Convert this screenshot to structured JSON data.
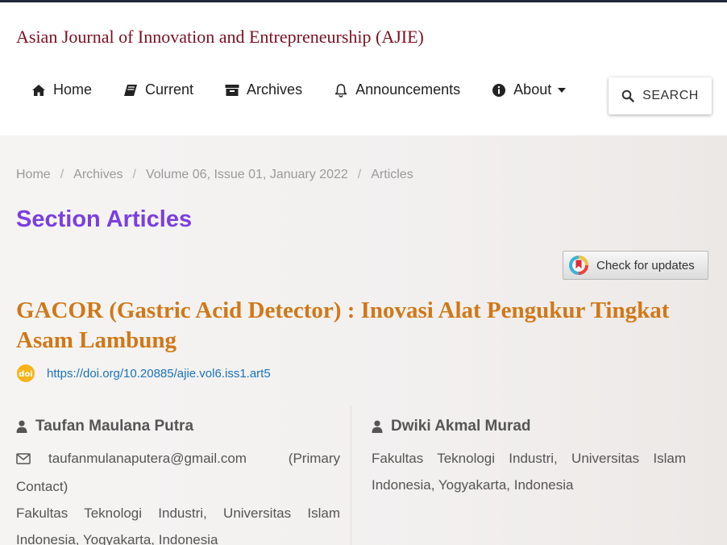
{
  "site": {
    "title": "Asian Journal of Innovation and Entrepreneurship (AJIE)"
  },
  "nav": {
    "items": [
      {
        "label": "Home",
        "icon": "home-icon"
      },
      {
        "label": "Current",
        "icon": "book-icon"
      },
      {
        "label": "Archives",
        "icon": "archive-icon"
      },
      {
        "label": "Announcements",
        "icon": "bell-icon"
      },
      {
        "label": "About",
        "icon": "info-icon"
      }
    ]
  },
  "search": {
    "label": "SEARCH",
    "icon": "search-icon"
  },
  "breadcrumb": {
    "items": [
      "Home",
      "Archives",
      "Volume 06, Issue 01, January 2022",
      "Articles"
    ],
    "separator": "/"
  },
  "section": {
    "title": "Section Articles"
  },
  "check_for_updates": {
    "label": "Check for updates"
  },
  "article": {
    "title": "GACOR (Gastric Acid Detector) : Inovasi Alat Pengukur Tingkat Asam Lambung",
    "doi_url": "https://doi.org/10.20885/ajie.vol6.iss1.art5"
  },
  "authors": [
    {
      "name": "Taufan Maulana Putra",
      "email": "taufanmulanaputera@gmail.com",
      "contact_note": "(Primary Contact)",
      "affiliation": "Fakultas Teknologi Industri, Universitas Islam Indonesia, Yogyakarta, Indonesia"
    },
    {
      "name": "Dwiki Akmal Murad",
      "affiliation": "Fakultas Teknologi Industri, Universitas Islam Indonesia, Yogyakarta, Indonesia"
    }
  ],
  "colors": {
    "site_title": "#7a1020",
    "section_title": "#7b3fe0",
    "article_title": "#d07818",
    "link": "#1a73b8"
  }
}
